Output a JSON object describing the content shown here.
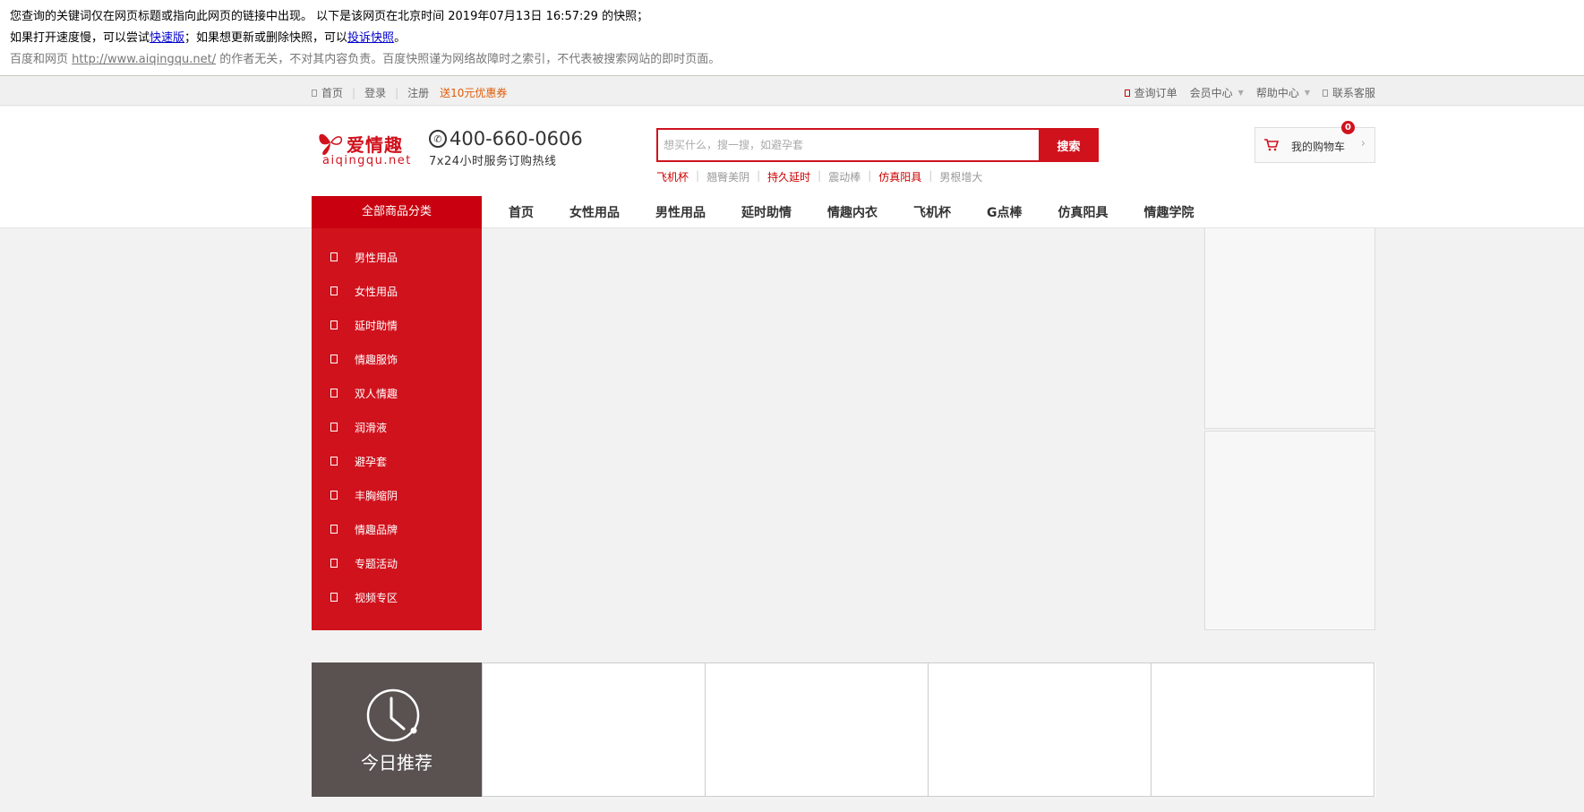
{
  "snapshot": {
    "line1": "您查询的关键词仅在网页标题或指向此网页的链接中出现。  以下是该网页在北京时间 2019年07月13日 16:57:29 的快照；",
    "line2_prefix": "如果打开速度慢，可以尝试",
    "line2_link1": "快速版",
    "line2_mid": "；如果想更新或删除快照，可以",
    "line2_link2": "投诉快照",
    "line2_suffix": "。",
    "line3_prefix": "百度和网页 ",
    "line3_url": "http://www.aiqingqu.net/",
    "line3_suffix": " 的作者无关，不对其内容负责。百度快照谨为网络故障时之索引，不代表被搜索网站的即时页面。"
  },
  "topbar": {
    "home": "首页",
    "login": "登录",
    "register": "注册",
    "coupon": "送10元优惠券",
    "orders": "查询订单",
    "member": "会员中心",
    "help": "帮助中心",
    "service": "联系客服"
  },
  "header": {
    "logo_cn": "爱情趣",
    "logo_en": "aiqingqu.net",
    "phone": "400-660-0606",
    "phone_sub": "7x24小时服务订购热线",
    "search_placeholder": "想买什么，搜一搜，如避孕套",
    "search_button": "搜索",
    "hotwords": [
      {
        "text": "飞机杯",
        "red": true
      },
      {
        "text": "翘臀美阴",
        "red": false
      },
      {
        "text": "持久延时",
        "red": true
      },
      {
        "text": "震动棒",
        "red": false
      },
      {
        "text": "仿真阳具",
        "red": true
      },
      {
        "text": "男根增大",
        "red": false
      }
    ],
    "cart_label": "我的购物车",
    "cart_count": "0"
  },
  "nav": {
    "all_categories": "全部商品分类",
    "items": [
      "首页",
      "女性用品",
      "男性用品",
      "延时助情",
      "情趣内衣",
      "飞机杯",
      "G点棒",
      "仿真阳具",
      "情趣学院"
    ]
  },
  "categories": [
    "男性用品",
    "女性用品",
    "延时助情",
    "情趣服饰",
    "双人情趣",
    "润滑液",
    "避孕套",
    "丰胸缩阴",
    "情趣品牌",
    "专题活动",
    "视频专区"
  ],
  "today": {
    "title": "今日推荐"
  },
  "colors": {
    "brand_red": "#d0121d",
    "today_bg": "#5a5151"
  }
}
